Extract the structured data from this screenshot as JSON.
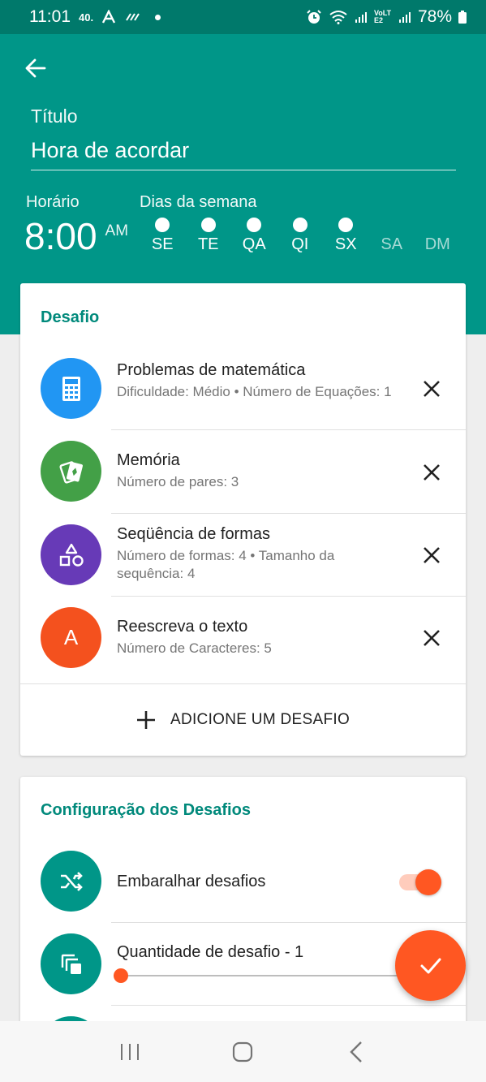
{
  "status_bar": {
    "time": "11:01",
    "indicator_text": "40.",
    "battery": "78%",
    "lte_text": "VoLTE2"
  },
  "header": {
    "title_label": "Título",
    "title_value": "Hora de acordar",
    "time_label": "Horário",
    "time_value": "8:00",
    "time_ampm": "AM",
    "days_label": "Dias da semana",
    "days": [
      {
        "label": "SE",
        "active": true
      },
      {
        "label": "TE",
        "active": true
      },
      {
        "label": "QA",
        "active": true
      },
      {
        "label": "QI",
        "active": true
      },
      {
        "label": "SX",
        "active": true
      },
      {
        "label": "SA",
        "active": false
      },
      {
        "label": "DM",
        "active": false
      }
    ]
  },
  "challenges": {
    "title": "Desafio",
    "items": [
      {
        "title": "Problemas de matemática",
        "subtitle": "Dificuldade: Médio • Número de Equações: 1",
        "icon": "calculator-icon",
        "color": "#2196f3"
      },
      {
        "title": "Memória",
        "subtitle": "Número de pares: 3",
        "icon": "cards-icon",
        "color": "#43a047"
      },
      {
        "title": "Seqüência de formas",
        "subtitle": "Número de formas: 4 • Tamanho da sequência: 4",
        "icon": "shapes-icon",
        "color": "#673ab7"
      },
      {
        "title": "Reescreva o texto",
        "subtitle": "Número de Caracteres: 5",
        "icon": "letter-icon",
        "letter": "A",
        "color": "#f4511e"
      }
    ],
    "add_label": "ADICIONE UM DESAFIO"
  },
  "settings": {
    "title": "Configuração dos Desafios",
    "shuffle_label": "Embaralhar desafios",
    "shuffle_enabled": true,
    "quantity_label": "Quantidade de desafio - 1",
    "quantity_slider_fraction": 0.0,
    "accent_color": "#009688"
  },
  "colors": {
    "header": "#009688",
    "status": "#00796b",
    "accent": "#ff5722"
  }
}
